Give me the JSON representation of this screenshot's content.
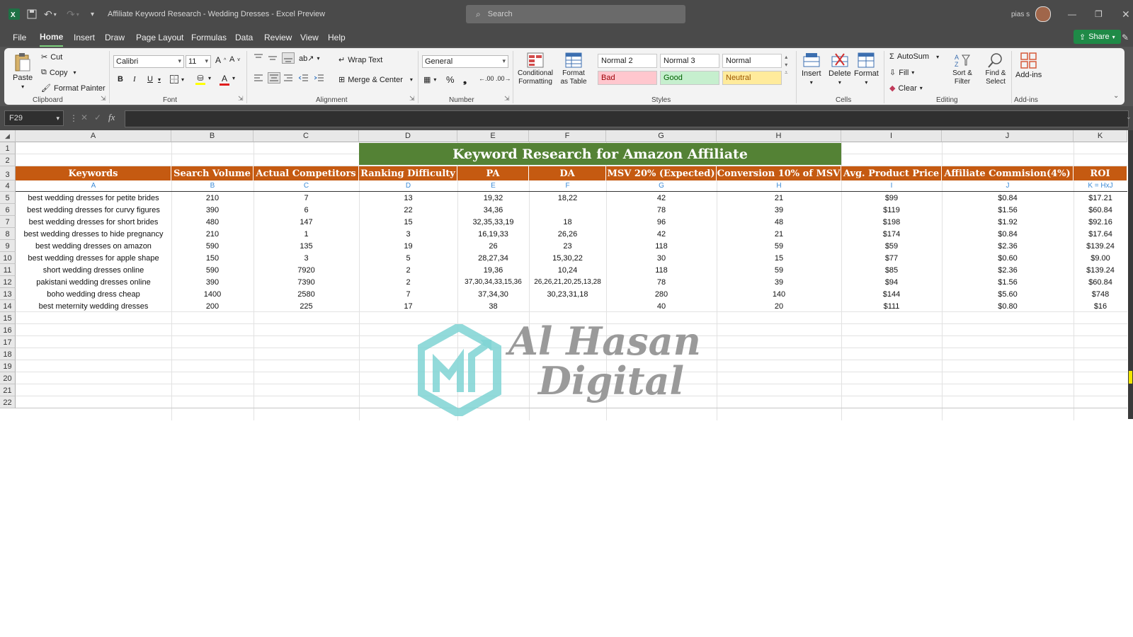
{
  "window": {
    "title": "Affiliate Keyword Research - Wedding Dresses  -  Excel Preview",
    "search_placeholder": "Search",
    "user": "pias s",
    "share_label": "Share"
  },
  "menu": [
    "File",
    "Home",
    "Insert",
    "Draw",
    "Page Layout",
    "Formulas",
    "Data",
    "Review",
    "View",
    "Help"
  ],
  "ribbon": {
    "clipboard": {
      "label": "Clipboard",
      "paste": "Paste",
      "cut": "Cut",
      "copy": "Copy",
      "format_painter": "Format Painter"
    },
    "font": {
      "label": "Font",
      "name": "Calibri",
      "size": "11"
    },
    "alignment": {
      "label": "Alignment",
      "wrap": "Wrap Text",
      "merge": "Merge & Center"
    },
    "number": {
      "label": "Number",
      "format": "General"
    },
    "styles": {
      "label": "Styles",
      "conditional": "Conditional Formatting",
      "format_table": "Format as Table",
      "cells": [
        "Normal 2",
        "Normal 3",
        "Normal",
        "Bad",
        "Good",
        "Neutral"
      ]
    },
    "cells": {
      "label": "Cells",
      "insert": "Insert",
      "delete": "Delete",
      "format": "Format"
    },
    "editing": {
      "label": "Editing",
      "autosum": "AutoSum",
      "fill": "Fill",
      "clear": "Clear",
      "sort": "Sort & Filter",
      "find": "Find & Select"
    },
    "addins": {
      "label": "Add-ins",
      "addins": "Add-ins"
    }
  },
  "formula_bar": {
    "name_box": "F29",
    "fx": "fx",
    "value": ""
  },
  "sheet": {
    "columns": [
      "A",
      "B",
      "C",
      "D",
      "E",
      "F",
      "G",
      "H",
      "I",
      "J",
      "K"
    ],
    "rows": [
      "1",
      "2",
      "3",
      "4",
      "5",
      "6",
      "7",
      "8",
      "9",
      "10",
      "11",
      "12",
      "13",
      "14",
      "15",
      "16",
      "17",
      "18",
      "19",
      "20",
      "21",
      "22"
    ],
    "banner": "Keyword Research for Amazon Affiliate",
    "headers": [
      "Keywords",
      "Search Volume",
      "Actual Competitors",
      "Ranking Difficulty",
      "PA",
      "DA",
      "MSV 20% (Expected)",
      "Conversion 10% of MSV",
      "Avg. Product Price",
      "Affiliate Commision(4%)",
      "ROI"
    ],
    "labels": [
      "A",
      "B",
      "C",
      "D",
      "E",
      "F",
      "G",
      "H",
      "I",
      "J",
      "K = HxJ"
    ],
    "data": [
      [
        "best wedding dresses for petite brides",
        "210",
        "7",
        "13",
        "19,32",
        "18,22",
        "42",
        "21",
        "$99",
        "$0.84",
        "$17.21"
      ],
      [
        "best wedding dresses for curvy figures",
        "390",
        "6",
        "22",
        "34,36",
        "",
        "78",
        "39",
        "$119",
        "$1.56",
        "$60.84"
      ],
      [
        "best wedding dresses for short brides",
        "480",
        "147",
        "15",
        "32,35,33,19",
        "18",
        "96",
        "48",
        "$198",
        "$1.92",
        "$92.16"
      ],
      [
        "best wedding dresses to hide pregnancy",
        "210",
        "1",
        "3",
        "16,19,33",
        "26,26",
        "42",
        "21",
        "$174",
        "$0.84",
        "$17.64"
      ],
      [
        "best wedding dresses on amazon",
        "590",
        "135",
        "19",
        "26",
        "23",
        "118",
        "59",
        "$59",
        "$2.36",
        "$139.24"
      ],
      [
        "best wedding dresses for apple shape",
        "150",
        "3",
        "5",
        "28,27,34",
        "15,30,22",
        "30",
        "15",
        "$77",
        "$0.60",
        "$9.00"
      ],
      [
        "short wedding dresses online",
        "590",
        "7920",
        "2",
        "19,36",
        "10,24",
        "118",
        "59",
        "$85",
        "$2.36",
        "$139.24"
      ],
      [
        "pakistani wedding dresses online",
        "390",
        "7390",
        "2",
        "37,30,34,33,15,36",
        "26,26,21,20,25,13,28",
        "78",
        "39",
        "$94",
        "$1.56",
        "$60.84"
      ],
      [
        "boho wedding dress cheap",
        "1400",
        "2580",
        "7",
        "37,34,30",
        "30,23,31,18",
        "280",
        "140",
        "$144",
        "$5.60",
        "$748"
      ],
      [
        "best meternity wedding dresses",
        "200",
        "225",
        "17",
        "38",
        "",
        "40",
        "20",
        "$111",
        "$0.80",
        "$16"
      ]
    ]
  },
  "watermark": {
    "line1": "Al Hasan",
    "line2": "Digital"
  }
}
